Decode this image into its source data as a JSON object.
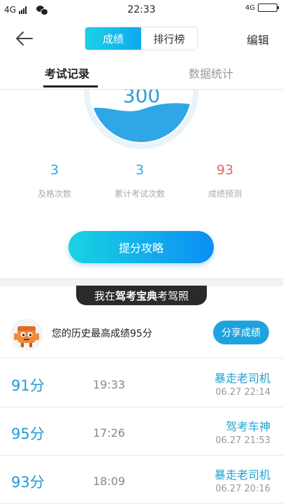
{
  "status_bar": {
    "network": "4G",
    "time": "22:33",
    "network_right": "4G"
  },
  "nav": {
    "tabs": [
      "成绩",
      "排行榜"
    ],
    "edit_label": "编辑"
  },
  "tabs": {
    "records": "考试记录",
    "stats": "数据统计"
  },
  "gauge": {
    "score": "300",
    "water_color": "#2fa6e6"
  },
  "stats": [
    {
      "value": "3",
      "label": "及格次数",
      "color": "#29a8dc"
    },
    {
      "value": "3",
      "label": "累计考试次数",
      "color": "#29a8dc"
    },
    {
      "value": "93",
      "label": "成绩预测",
      "color": "#e4685e"
    }
  ],
  "cta_label": "提分攻略",
  "badge": {
    "prefix": "我在",
    "brand": "驾考宝典",
    "suffix": "考驾照"
  },
  "best": {
    "text": "您的历史最高成绩95分",
    "share_label": "分享成绩"
  },
  "records": [
    {
      "score": "91分",
      "time": "19:33",
      "title": "暴走老司机",
      "date": "06.27  22:14"
    },
    {
      "score": "95分",
      "time": "17:26",
      "title": "驾考车神",
      "date": "06.27  21:53"
    },
    {
      "score": "93分",
      "time": "18:09",
      "title": "暴走老司机",
      "date": "06.27  20:16"
    }
  ]
}
